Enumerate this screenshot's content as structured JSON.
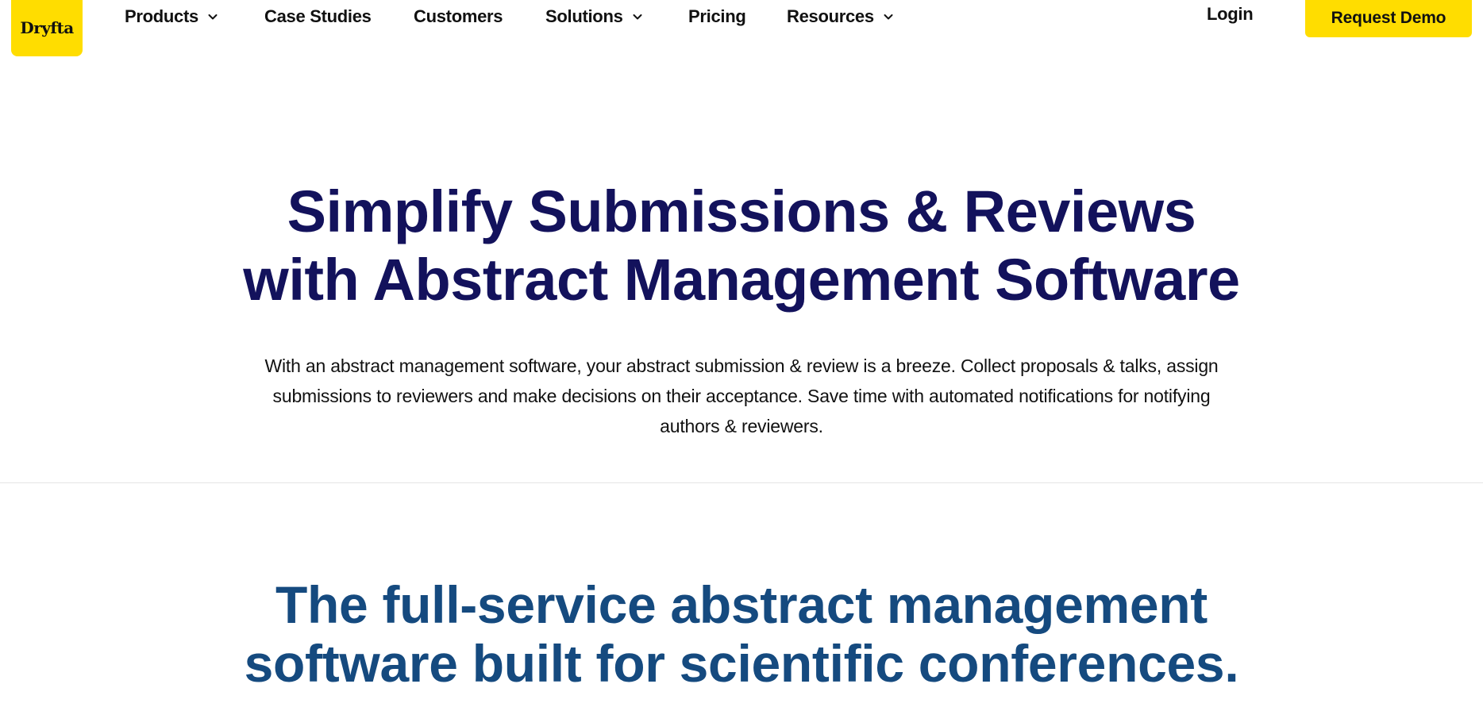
{
  "header": {
    "logo_text": "Dryfta",
    "nav": [
      {
        "label": "Products",
        "has_dropdown": true
      },
      {
        "label": "Case Studies",
        "has_dropdown": false
      },
      {
        "label": "Customers",
        "has_dropdown": false
      },
      {
        "label": "Solutions",
        "has_dropdown": true
      },
      {
        "label": "Pricing",
        "has_dropdown": false
      },
      {
        "label": "Resources",
        "has_dropdown": true
      }
    ],
    "login_label": "Login",
    "cta_label": "Request Demo"
  },
  "hero": {
    "title_line1": "Simplify Submissions & Reviews",
    "title_line2": "with Abstract Management Software",
    "description": "With an abstract management software, your abstract submission & review is a breeze. Collect proposals & talks, assign submissions to reviewers and make decisions on their acceptance. Save time with automated notifications for notifying authors & reviewers."
  },
  "section2": {
    "title_line1": "The full-service abstract management",
    "title_line2": "software built for scientific conferences."
  },
  "colors": {
    "brand_yellow": "#FFDD00",
    "hero_title": "#13125C",
    "section_title": "#154A7F",
    "text": "#111111"
  },
  "icons": {
    "dropdown": "chevron-down-icon"
  }
}
